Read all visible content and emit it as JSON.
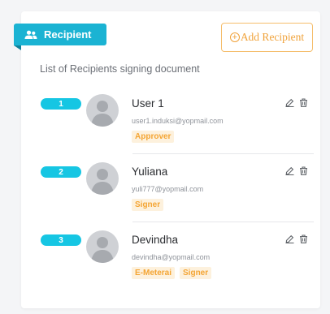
{
  "panel": {
    "title": "Recipient",
    "add_button_label": "Add Recipient",
    "subtitle": "List of Recipients signing document"
  },
  "recipients": [
    {
      "order": "1",
      "name": "User 1",
      "email": "user1.induksi@yopmail.com",
      "roles": [
        "Approver"
      ]
    },
    {
      "order": "2",
      "name": "Yuliana",
      "email": "yuli777@yopmail.com",
      "roles": [
        "Signer"
      ]
    },
    {
      "order": "3",
      "name": "Devindha",
      "email": "devindha@yopmail.com",
      "roles": [
        "E-Meterai",
        "Signer"
      ]
    }
  ],
  "colors": {
    "accent": "#1bb3d3",
    "order_badge": "#16c6e3",
    "role_tag_bg": "#fdf1dd",
    "role_tag_text": "#f4a534",
    "add_button": "#f0a23a"
  },
  "icons": {
    "header": "users-icon",
    "add": "plus-circle-icon",
    "edit": "pencil-icon",
    "delete": "trash-icon",
    "avatar": "user-avatar-icon"
  }
}
